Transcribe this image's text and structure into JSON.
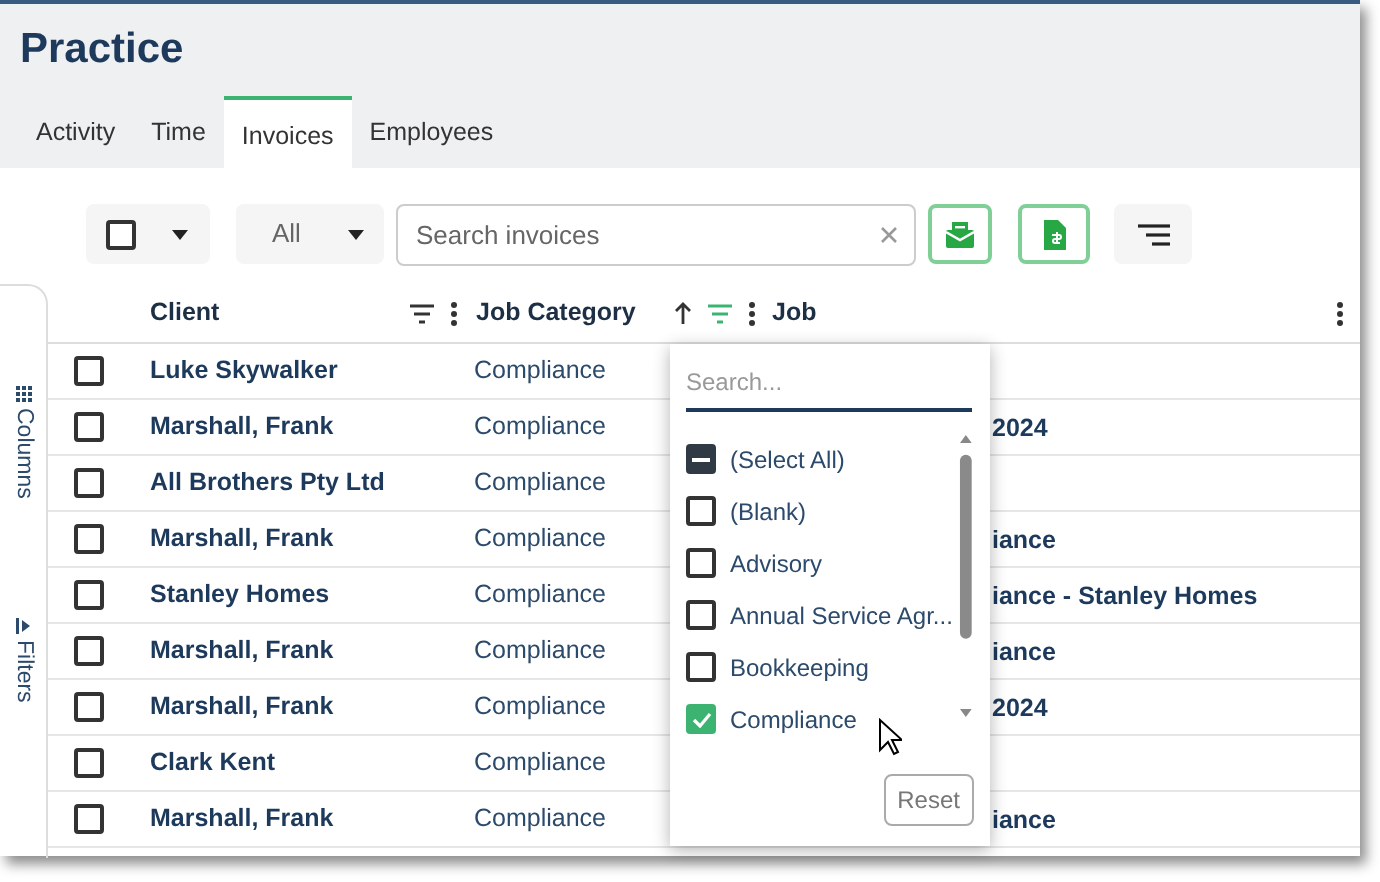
{
  "title": "Practice",
  "tabs": [
    {
      "label": "Activity",
      "selected": false
    },
    {
      "label": "Time",
      "selected": false
    },
    {
      "label": "Invoices",
      "selected": true
    },
    {
      "label": "Employees",
      "selected": false
    }
  ],
  "toolbar": {
    "select_checked": false,
    "status_filter": "All",
    "search": {
      "placeholder": "Search invoices"
    }
  },
  "side_panel": [
    {
      "kind": "columns",
      "label": "Columns"
    },
    {
      "kind": "filters",
      "label": "Filters"
    }
  ],
  "table": {
    "columns": [
      {
        "label": "Client",
        "sorted_ascending": false,
        "has_filter": true,
        "filter_active": false
      },
      {
        "label": "Job Category",
        "sorted_ascending": true,
        "has_filter": true,
        "filter_active": true
      },
      {
        "label": "Job",
        "sorted_ascending": false,
        "has_filter": false
      }
    ],
    "rows": [
      {
        "checked": false,
        "client": "Luke Skywalker",
        "job_category": "Compliance"
      },
      {
        "checked": false,
        "client": "Marshall, Frank",
        "job_category": "Compliance",
        "job": "2024"
      },
      {
        "checked": false,
        "client": "All Brothers Pty Ltd",
        "job_category": "Compliance"
      },
      {
        "checked": false,
        "client": "Marshall, Frank",
        "job_category": "Compliance",
        "job": "iance"
      },
      {
        "checked": false,
        "client": "Stanley Homes",
        "job_category": "Compliance",
        "job": "iance - Stanley Homes"
      },
      {
        "checked": false,
        "client": "Marshall, Frank",
        "job_category": "Compliance",
        "job": "iance"
      },
      {
        "checked": false,
        "client": "Marshall, Frank",
        "job_category": "Compliance",
        "job": "2024"
      },
      {
        "checked": false,
        "client": "Clark Kent",
        "job_category": "Compliance"
      },
      {
        "checked": false,
        "client": "Marshall, Frank",
        "job_category": "Compliance",
        "job": "iance"
      }
    ]
  },
  "filter_popup": {
    "placeholder": "Search...",
    "items": [
      {
        "label": "(Select All)",
        "indeterminate": true
      },
      {
        "label": "(Blank)",
        "checked": false
      },
      {
        "label": "Advisory",
        "checked": false
      },
      {
        "label": "Annual Service Agr...",
        "checked": false
      },
      {
        "label": "Bookkeeping",
        "checked": false
      },
      {
        "label": "Compliance",
        "checked": true
      }
    ],
    "reset": "Reset"
  }
}
